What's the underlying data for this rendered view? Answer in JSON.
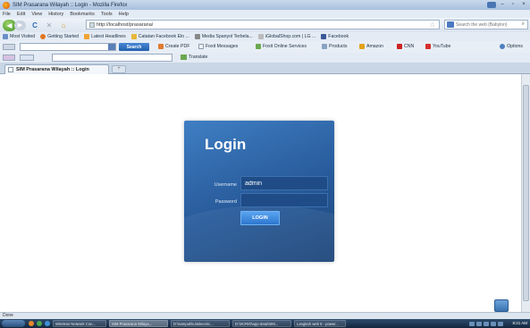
{
  "window": {
    "title": "SIM Prasarana Wilayah :: Login - Mozilla Firefox"
  },
  "menu": [
    "File",
    "Edit",
    "View",
    "History",
    "Bookmarks",
    "Tools",
    "Help"
  ],
  "nav": {
    "url": "http://localhost/prasarana/",
    "search_placeholder": "Search the web (Babylon)"
  },
  "bookmarks": [
    {
      "label": "Most Visited",
      "color": "#6b8fc7"
    },
    {
      "label": "Getting Started",
      "color": "#e0761f"
    },
    {
      "label": "Latest Headlines",
      "color": "#f0a431"
    },
    {
      "label": "Catatan Facebook Elo ...",
      "color": "#e8b73a"
    },
    {
      "label": "Media Spanyol Terbela...",
      "color": "#888888"
    },
    {
      "label": "iGlobalShop.com | LG ...",
      "color": "#bbbbbb"
    },
    {
      "label": "Facebook",
      "color": "#3b5998"
    }
  ],
  "toolbar2": {
    "search_button": "Search",
    "create_pdf": "Create PDF",
    "foxit_messages": "Foxit Messages",
    "foxit_services": "Foxit Online Services",
    "products": "Products",
    "amazon": "Amazon",
    "cnn": "CNN",
    "youtube": "YouTube",
    "options": "Options"
  },
  "toolbar3": {
    "translate": "Translate"
  },
  "tab": {
    "label": "SIM Prasarana Wilayah :: Login",
    "new_tab": "+"
  },
  "login": {
    "title": "Login",
    "username_label": "Username",
    "username_value": "admin",
    "password_label": "Password",
    "button": "LOGIN"
  },
  "status": "Done",
  "taskbar": {
    "tasks": [
      "Wireless Network Con...",
      "SIM Prasarana Wilaya...",
      "D:\\sampahku\\tokecs\\c...",
      "D:\\SCRID\\app-data\\SIM...",
      "Langkah web 5 - power..."
    ],
    "clock": "8:21 AM"
  }
}
